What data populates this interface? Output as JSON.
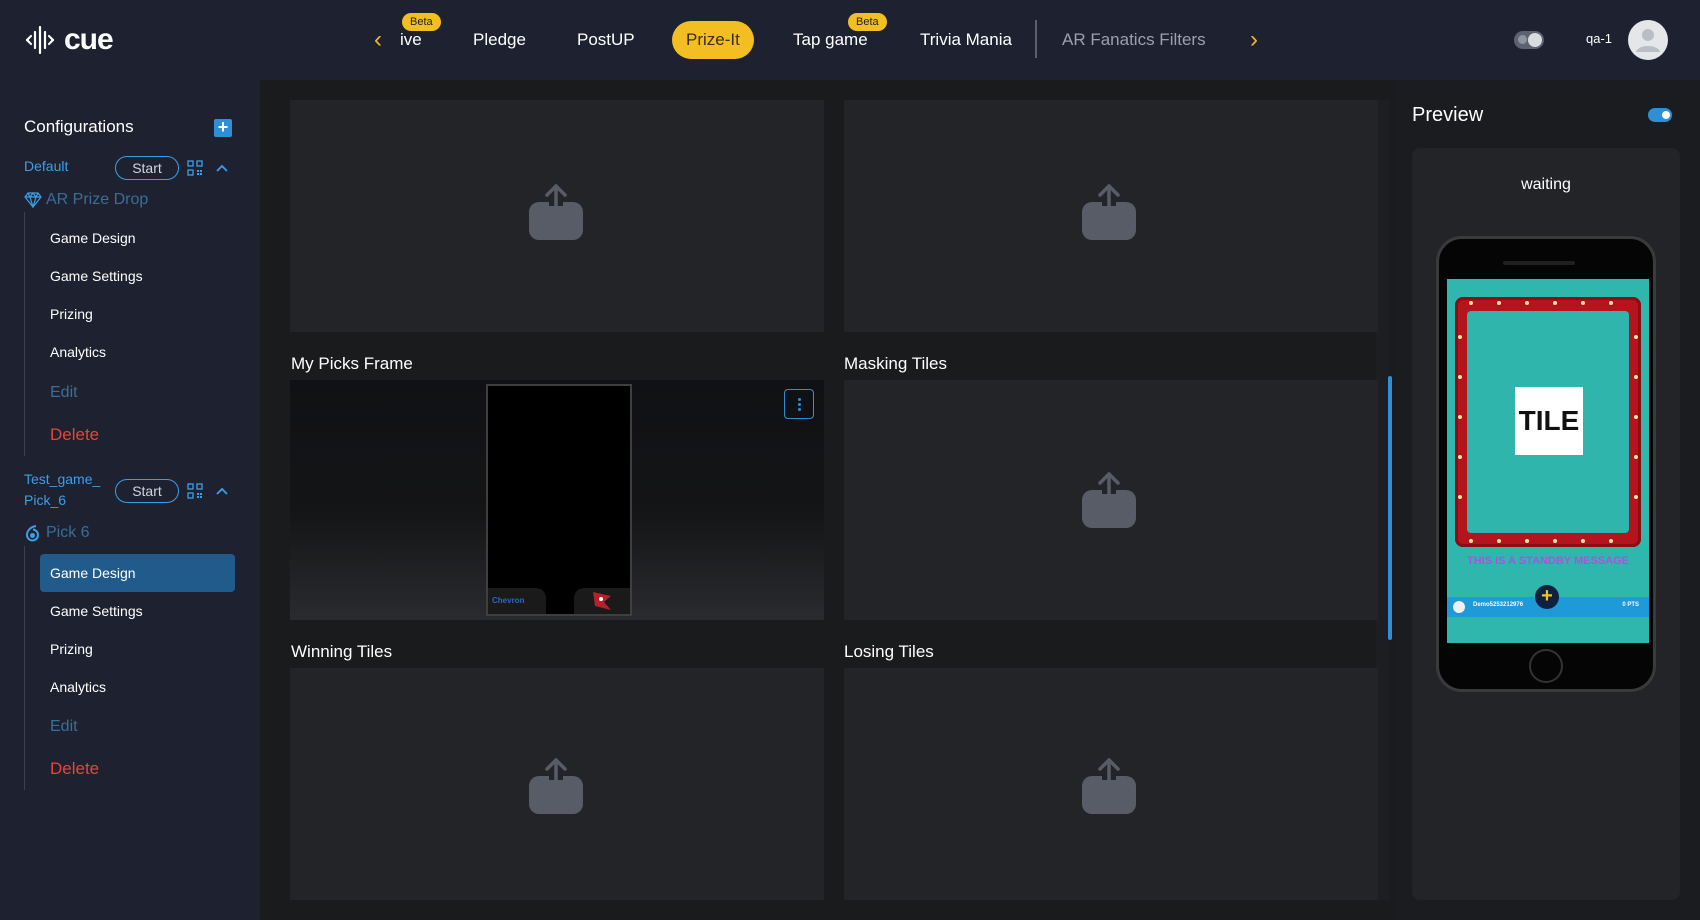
{
  "app": {
    "logo_text": "cue",
    "user_name": "qa-1"
  },
  "topnav": {
    "tabs": [
      {
        "label": "ive",
        "beta": "Beta"
      },
      {
        "label": "Pledge"
      },
      {
        "label": "PostUP"
      },
      {
        "label": "Prize-It",
        "active": true
      },
      {
        "label": "Tap game",
        "beta": "Beta"
      },
      {
        "label": "Trivia Mania"
      },
      {
        "label": "AR Fanatics Filters"
      }
    ],
    "accent_color": "#f2be22"
  },
  "sidebar": {
    "title": "Configurations",
    "configs": [
      {
        "name": "Default",
        "start_label": "Start",
        "game_type": "AR Prize Drop",
        "items": [
          "Game Design",
          "Game Settings",
          "Prizing",
          "Analytics",
          "Edit",
          "Delete"
        ]
      },
      {
        "name_line1": "Test_game_",
        "name_line2": "Pick_6",
        "start_label": "Start",
        "game_type": "Pick 6",
        "items": [
          "Game Design",
          "Game Settings",
          "Prizing",
          "Analytics",
          "Edit",
          "Delete"
        ],
        "active_item": "Game Design"
      }
    ]
  },
  "main": {
    "sections": [
      {
        "label": "My Picks Frame"
      },
      {
        "label": "Masking Tiles"
      },
      {
        "label": "Winning Tiles"
      },
      {
        "label": "Losing Tiles"
      }
    ]
  },
  "preview": {
    "title": "Preview",
    "status": "waiting",
    "tile_text": "TILE",
    "standby_message": "THIS IS A STANDBY MESSAGE",
    "player_name": "Demo5253212976",
    "points": "0 PTS",
    "sponsor": "Chevron"
  }
}
